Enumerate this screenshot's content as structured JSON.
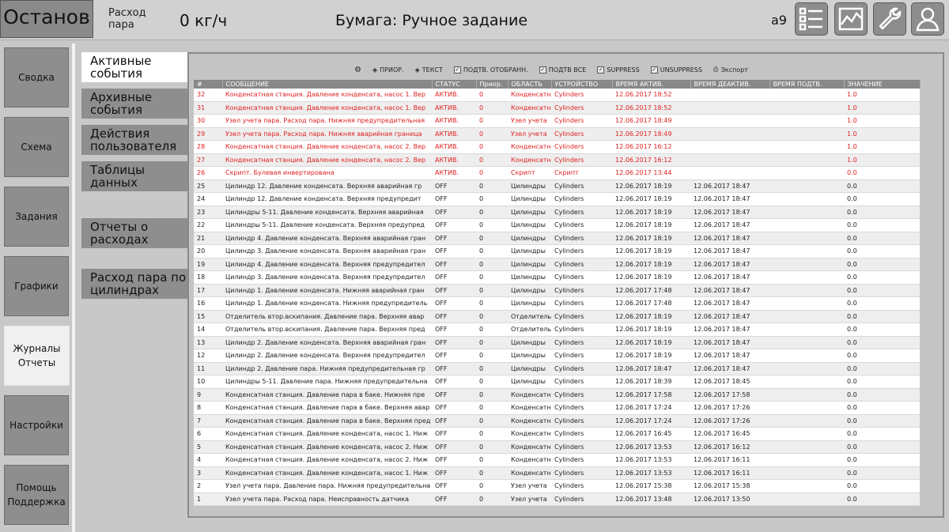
{
  "header": {
    "status": "Останов",
    "flow_label": "Расход пара",
    "flow_value": "0 кг/ч",
    "paper": "Бумага: Ручное задание",
    "user": "a9"
  },
  "toolbar_icons": [
    "list-icon",
    "trend-chart-icon",
    "wrench-icon",
    "user-icon"
  ],
  "nav": [
    {
      "label": "Сводка"
    },
    {
      "label": "Схема"
    },
    {
      "label": "Задания"
    },
    {
      "label": "Графики"
    },
    {
      "label": "Журналы Отчеты",
      "active": true
    },
    {
      "label": "Настройки"
    },
    {
      "label": "Помощь Поддержка"
    }
  ],
  "subnav": [
    {
      "label": "Активные события",
      "active": true
    },
    {
      "label": "Архивные события"
    },
    {
      "label": "Действия пользователя"
    },
    {
      "label": "Таблицы данных"
    },
    {
      "label": "Отчеты о расходах"
    },
    {
      "label": "Расход пара по цилиндрах"
    }
  ],
  "grid_toolbar": {
    "prior": "ПРИОР.",
    "text": "ТЕКСТ",
    "ack_selected": "ПОДТВ. ОТОБРАНН.",
    "ack_all": "ПОДТВ ВСЕ",
    "suppress": "SUPPRESS",
    "unsuppress": "UNSUPPRESS",
    "export": "Экспорт"
  },
  "columns": [
    "#",
    "СООБЩЕНИЕ",
    "СТАТУС",
    "Приор.",
    "ОБЛАСТЬ",
    "УСТРОЙСТВО",
    "ВРЕМЯ АКТИВ.",
    "ВРЕМЯ ДЕАКТИВ.",
    "ВРЕМЯ ПОДТВ.",
    "ЗНАЧЕНИЕ"
  ],
  "rows": [
    {
      "n": "32",
      "msg": "Конденсатная станция. Давление конденсата, насос 1. Вер",
      "status": "АКТИВ.",
      "prior": "0",
      "area": "Конденсатная",
      "device": "Cylinders",
      "t_on": "12.06.2017 18:52",
      "t_off": "",
      "t_ack": "",
      "value": "1.0",
      "active": true
    },
    {
      "n": "31",
      "msg": "Конденсатная станция. Давление конденсата, насос 1. Вер",
      "status": "АКТИВ.",
      "prior": "0",
      "area": "Конденсатная",
      "device": "Cylinders",
      "t_on": "12.06.2017 18:52",
      "t_off": "",
      "t_ack": "",
      "value": "1.0",
      "active": true
    },
    {
      "n": "30",
      "msg": "Узел учета пара. Расход пара. Нижняя предупредительная",
      "status": "АКТИВ.",
      "prior": "0",
      "area": "Узел учета",
      "device": "Cylinders",
      "t_on": "12.06.2017 18:49",
      "t_off": "",
      "t_ack": "",
      "value": "1.0",
      "active": true
    },
    {
      "n": "29",
      "msg": "Узел учета пара. Расход пара. Нижняя аварийная граница",
      "status": "АКТИВ.",
      "prior": "0",
      "area": "Узел учета",
      "device": "Cylinders",
      "t_on": "12.06.2017 18:49",
      "t_off": "",
      "t_ack": "",
      "value": "1.0",
      "active": true
    },
    {
      "n": "28",
      "msg": "Конденсатная станция. Давление конденсата, насос 2. Вер",
      "status": "АКТИВ.",
      "prior": "0",
      "area": "Конденсатная",
      "device": "Cylinders",
      "t_on": "12.06.2017 16:12",
      "t_off": "",
      "t_ack": "",
      "value": "1.0",
      "active": true
    },
    {
      "n": "27",
      "msg": "Конденсатная станция. Давление конденсата, насос 2. Вер",
      "status": "АКТИВ.",
      "prior": "0",
      "area": "Конденсатная",
      "device": "Cylinders",
      "t_on": "12.06.2017 16:12",
      "t_off": "",
      "t_ack": "",
      "value": "1.0",
      "active": true
    },
    {
      "n": "26",
      "msg": "Скрипт. Булевая инвертирована",
      "status": "АКТИВ.",
      "prior": "0",
      "area": "Скрипт",
      "device": "Скрипт",
      "t_on": "12.06.2017 13:44",
      "t_off": "",
      "t_ack": "",
      "value": "0.0",
      "active": true
    },
    {
      "n": "25",
      "msg": "Цилиндр 12. Давление конденсата. Верхняя аварийная гр",
      "status": "OFF",
      "prior": "0",
      "area": "Цилиндры",
      "device": "Cylinders",
      "t_on": "12.06.2017 18:19",
      "t_off": "12.06.2017 18:47",
      "t_ack": "",
      "value": "0.0"
    },
    {
      "n": "24",
      "msg": "Цилиндр 12. Давление конденсата. Верхняя предупредит",
      "status": "OFF",
      "prior": "0",
      "area": "Цилиндры",
      "device": "Cylinders",
      "t_on": "12.06.2017 18:19",
      "t_off": "12.06.2017 18:47",
      "t_ack": "",
      "value": "0.0"
    },
    {
      "n": "23",
      "msg": "Цилиндры 5-11. Давление конденсата. Верхняя аварийная",
      "status": "OFF",
      "prior": "0",
      "area": "Цилиндры",
      "device": "Cylinders",
      "t_on": "12.06.2017 18:19",
      "t_off": "12.06.2017 18:47",
      "t_ack": "",
      "value": "0.0"
    },
    {
      "n": "22",
      "msg": "Цилиндры 5-11. Давление конденсата. Верхняя предупред",
      "status": "OFF",
      "prior": "0",
      "area": "Цилиндры",
      "device": "Cylinders",
      "t_on": "12.06.2017 18:19",
      "t_off": "12.06.2017 18:47",
      "t_ack": "",
      "value": "0.0"
    },
    {
      "n": "21",
      "msg": "Цилиндр 4. Давление конденсата. Верхняя аварийная гран",
      "status": "OFF",
      "prior": "0",
      "area": "Цилиндры",
      "device": "Cylinders",
      "t_on": "12.06.2017 18:19",
      "t_off": "12.06.2017 18:47",
      "t_ack": "",
      "value": "0.0"
    },
    {
      "n": "20",
      "msg": "Цилиндр 3. Давление конденсата. Верхняя аварийная гран",
      "status": "OFF",
      "prior": "0",
      "area": "Цилиндры",
      "device": "Cylinders",
      "t_on": "12.06.2017 18:19",
      "t_off": "12.06.2017 18:47",
      "t_ack": "",
      "value": "0.0"
    },
    {
      "n": "19",
      "msg": "Цилиндр 4. Давление конденсата. Верхняя предупредител",
      "status": "OFF",
      "prior": "0",
      "area": "Цилиндры",
      "device": "Cylinders",
      "t_on": "12.06.2017 18:19",
      "t_off": "12.06.2017 18:47",
      "t_ack": "",
      "value": "0.0"
    },
    {
      "n": "18",
      "msg": "Цилиндр 3. Давление конденсата. Верхняя предупредител",
      "status": "OFF",
      "prior": "0",
      "area": "Цилиндры",
      "device": "Cylinders",
      "t_on": "12.06.2017 18:19",
      "t_off": "12.06.2017 18:47",
      "t_ack": "",
      "value": "0.0"
    },
    {
      "n": "17",
      "msg": "Цилиндр 1. Давление конденсата. Нижняя аварийная гран",
      "status": "OFF",
      "prior": "0",
      "area": "Цилиндры",
      "device": "Cylinders",
      "t_on": "12.06.2017 17:48",
      "t_off": "12.06.2017 18:47",
      "t_ack": "",
      "value": "0.0"
    },
    {
      "n": "16",
      "msg": "Цилиндр 1. Давление конденсата. Нижняя предупредитель",
      "status": "OFF",
      "prior": "0",
      "area": "Цилиндры",
      "device": "Cylinders",
      "t_on": "12.06.2017 17:48",
      "t_off": "12.06.2017 18:47",
      "t_ack": "",
      "value": "0.0"
    },
    {
      "n": "15",
      "msg": "Отделитель втор.вскипания. Давление пара. Верхняя авар",
      "status": "OFF",
      "prior": "0",
      "area": "Отделитель",
      "device": "Cylinders",
      "t_on": "12.06.2017 18:19",
      "t_off": "12.06.2017 18:47",
      "t_ack": "",
      "value": "0.0"
    },
    {
      "n": "14",
      "msg": "Отделитель втор.вскипания. Давление пара. Верхняя пред",
      "status": "OFF",
      "prior": "0",
      "area": "Отделитель",
      "device": "Cylinders",
      "t_on": "12.06.2017 18:19",
      "t_off": "12.06.2017 18:47",
      "t_ack": "",
      "value": "0.0"
    },
    {
      "n": "13",
      "msg": "Цилиндр 2. Давление конденсата. Верхняя аварийная гран",
      "status": "OFF",
      "prior": "0",
      "area": "Цилиндры",
      "device": "Cylinders",
      "t_on": "12.06.2017 18:19",
      "t_off": "12.06.2017 18:47",
      "t_ack": "",
      "value": "0.0"
    },
    {
      "n": "12",
      "msg": "Цилиндр 2. Давление конденсата. Верхняя предупредител",
      "status": "OFF",
      "prior": "0",
      "area": "Цилиндры",
      "device": "Cylinders",
      "t_on": "12.06.2017 18:19",
      "t_off": "12.06.2017 18:47",
      "t_ack": "",
      "value": "0.0"
    },
    {
      "n": "11",
      "msg": "Цилиндр 2. Давление пара. Нижняя предупредительная гр",
      "status": "OFF",
      "prior": "0",
      "area": "Цилиндры",
      "device": "Cylinders",
      "t_on": "12.06.2017 18:47",
      "t_off": "12.06.2017 18:47",
      "t_ack": "",
      "value": "0.0"
    },
    {
      "n": "10",
      "msg": "Цилиндры 5-11. Давление пара. Нижняя предупредительна",
      "status": "OFF",
      "prior": "0",
      "area": "Цилиндры",
      "device": "Cylinders",
      "t_on": "12.06.2017 18:39",
      "t_off": "12.06.2017 18:45",
      "t_ack": "",
      "value": "0.0"
    },
    {
      "n": "9",
      "msg": "Конденсатная станция. Давление пара в баке. Нижняя пре",
      "status": "OFF",
      "prior": "0",
      "area": "Конденсатная",
      "device": "Cylinders",
      "t_on": "12.06.2017 17:58",
      "t_off": "12.06.2017 17:58",
      "t_ack": "",
      "value": "0.0"
    },
    {
      "n": "8",
      "msg": "Конденсатная станция. Давление пара в баке. Верхняя авар",
      "status": "OFF",
      "prior": "0",
      "area": "Конденсатная",
      "device": "Cylinders",
      "t_on": "12.06.2017 17:24",
      "t_off": "12.06.2017 17:26",
      "t_ack": "",
      "value": "0.0"
    },
    {
      "n": "7",
      "msg": "Конденсатная станция. Давление пара в баке. Верхняя пред",
      "status": "OFF",
      "prior": "0",
      "area": "Конденсатная",
      "device": "Cylinders",
      "t_on": "12.06.2017 17:24",
      "t_off": "12.06.2017 17:26",
      "t_ack": "",
      "value": "0.0"
    },
    {
      "n": "6",
      "msg": "Конденсатная станция. Давление конденсата, насос 1. Ниж",
      "status": "OFF",
      "prior": "0",
      "area": "Конденсатная",
      "device": "Cylinders",
      "t_on": "12.06.2017 16:45",
      "t_off": "12.06.2017 16:45",
      "t_ack": "",
      "value": "0.0"
    },
    {
      "n": "5",
      "msg": "Конденсатная станция. Давление конденсата, насос 2. Ниж",
      "status": "OFF",
      "prior": "0",
      "area": "Конденсатная",
      "device": "Cylinders",
      "t_on": "12.06.2017 13:53",
      "t_off": "12.06.2017 16:12",
      "t_ack": "",
      "value": "0.0"
    },
    {
      "n": "4",
      "msg": "Конденсатная станция. Давление конденсата, насос 2. Ниж",
      "status": "OFF",
      "prior": "0",
      "area": "Конденсатная",
      "device": "Cylinders",
      "t_on": "12.06.2017 13:53",
      "t_off": "12.06.2017 16:11",
      "t_ack": "",
      "value": "0.0"
    },
    {
      "n": "3",
      "msg": "Конденсатная станция. Давление конденсата, насос 1. Ниж",
      "status": "OFF",
      "prior": "0",
      "area": "Конденсатная",
      "device": "Cylinders",
      "t_on": "12.06.2017 13:53",
      "t_off": "12.06.2017 16:11",
      "t_ack": "",
      "value": "0.0"
    },
    {
      "n": "2",
      "msg": "Узел учета пара. Давление пара. Нижняя предупредительна",
      "status": "OFF",
      "prior": "0",
      "area": "Узел учета",
      "device": "Cylinders",
      "t_on": "12.06.2017 15:38",
      "t_off": "12.06.2017 15:38",
      "t_ack": "",
      "value": "0.0"
    },
    {
      "n": "1",
      "msg": "Узел учета пара. Расход пара. Неисправность датчика",
      "status": "OFF",
      "prior": "0",
      "area": "Узел учета",
      "device": "Cylinders",
      "t_on": "12.06.2017 13:48",
      "t_off": "12.06.2017 13:50",
      "t_ack": "",
      "value": "0.0"
    }
  ]
}
